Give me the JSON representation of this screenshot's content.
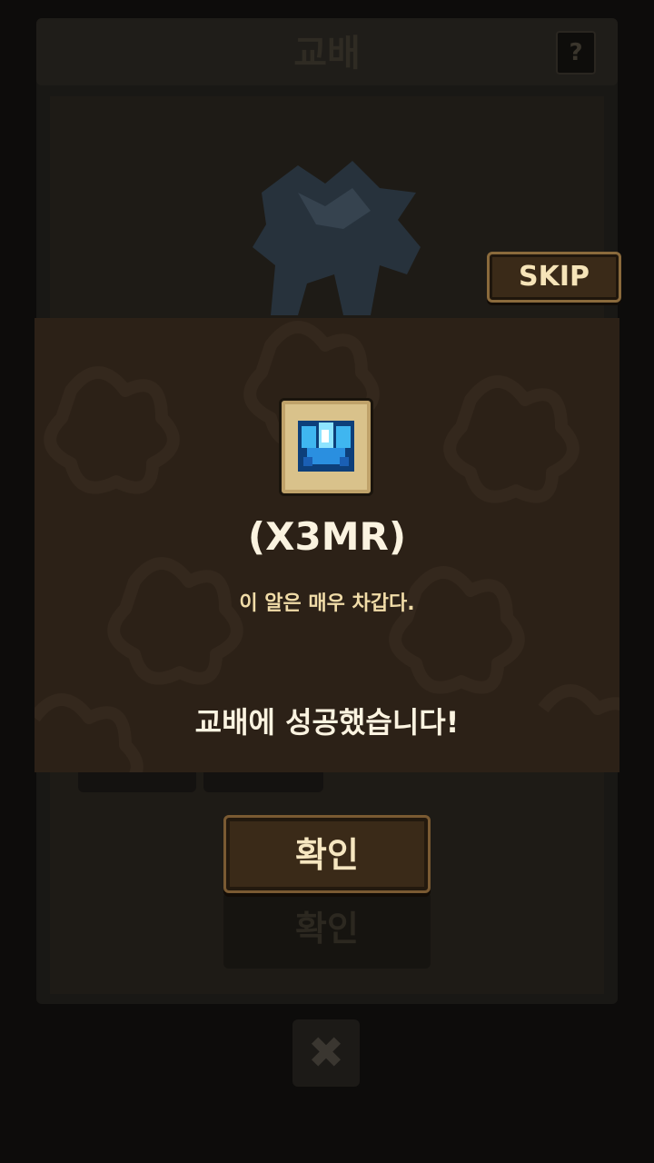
{
  "header": {
    "title": "교배",
    "help_icon": "help-icon"
  },
  "skip_button": {
    "label": "SKIP"
  },
  "result": {
    "item_name": "(X3MR)",
    "item_description": "이 알은 매우 차갑다.",
    "message": "교배에 성공했습니다!",
    "item_icon": "ice-crystal-egg-icon"
  },
  "confirm_button": {
    "label": "확인"
  },
  "confirm_ghost": {
    "label": "확인"
  },
  "close_button": {
    "icon": "close-icon",
    "glyph": "✖"
  },
  "colors": {
    "popup_bg": "#2c2117",
    "button_bg": "#3a2a18",
    "text_cream": "#fbf3e0",
    "ice_blue": "#3fb6f0"
  }
}
